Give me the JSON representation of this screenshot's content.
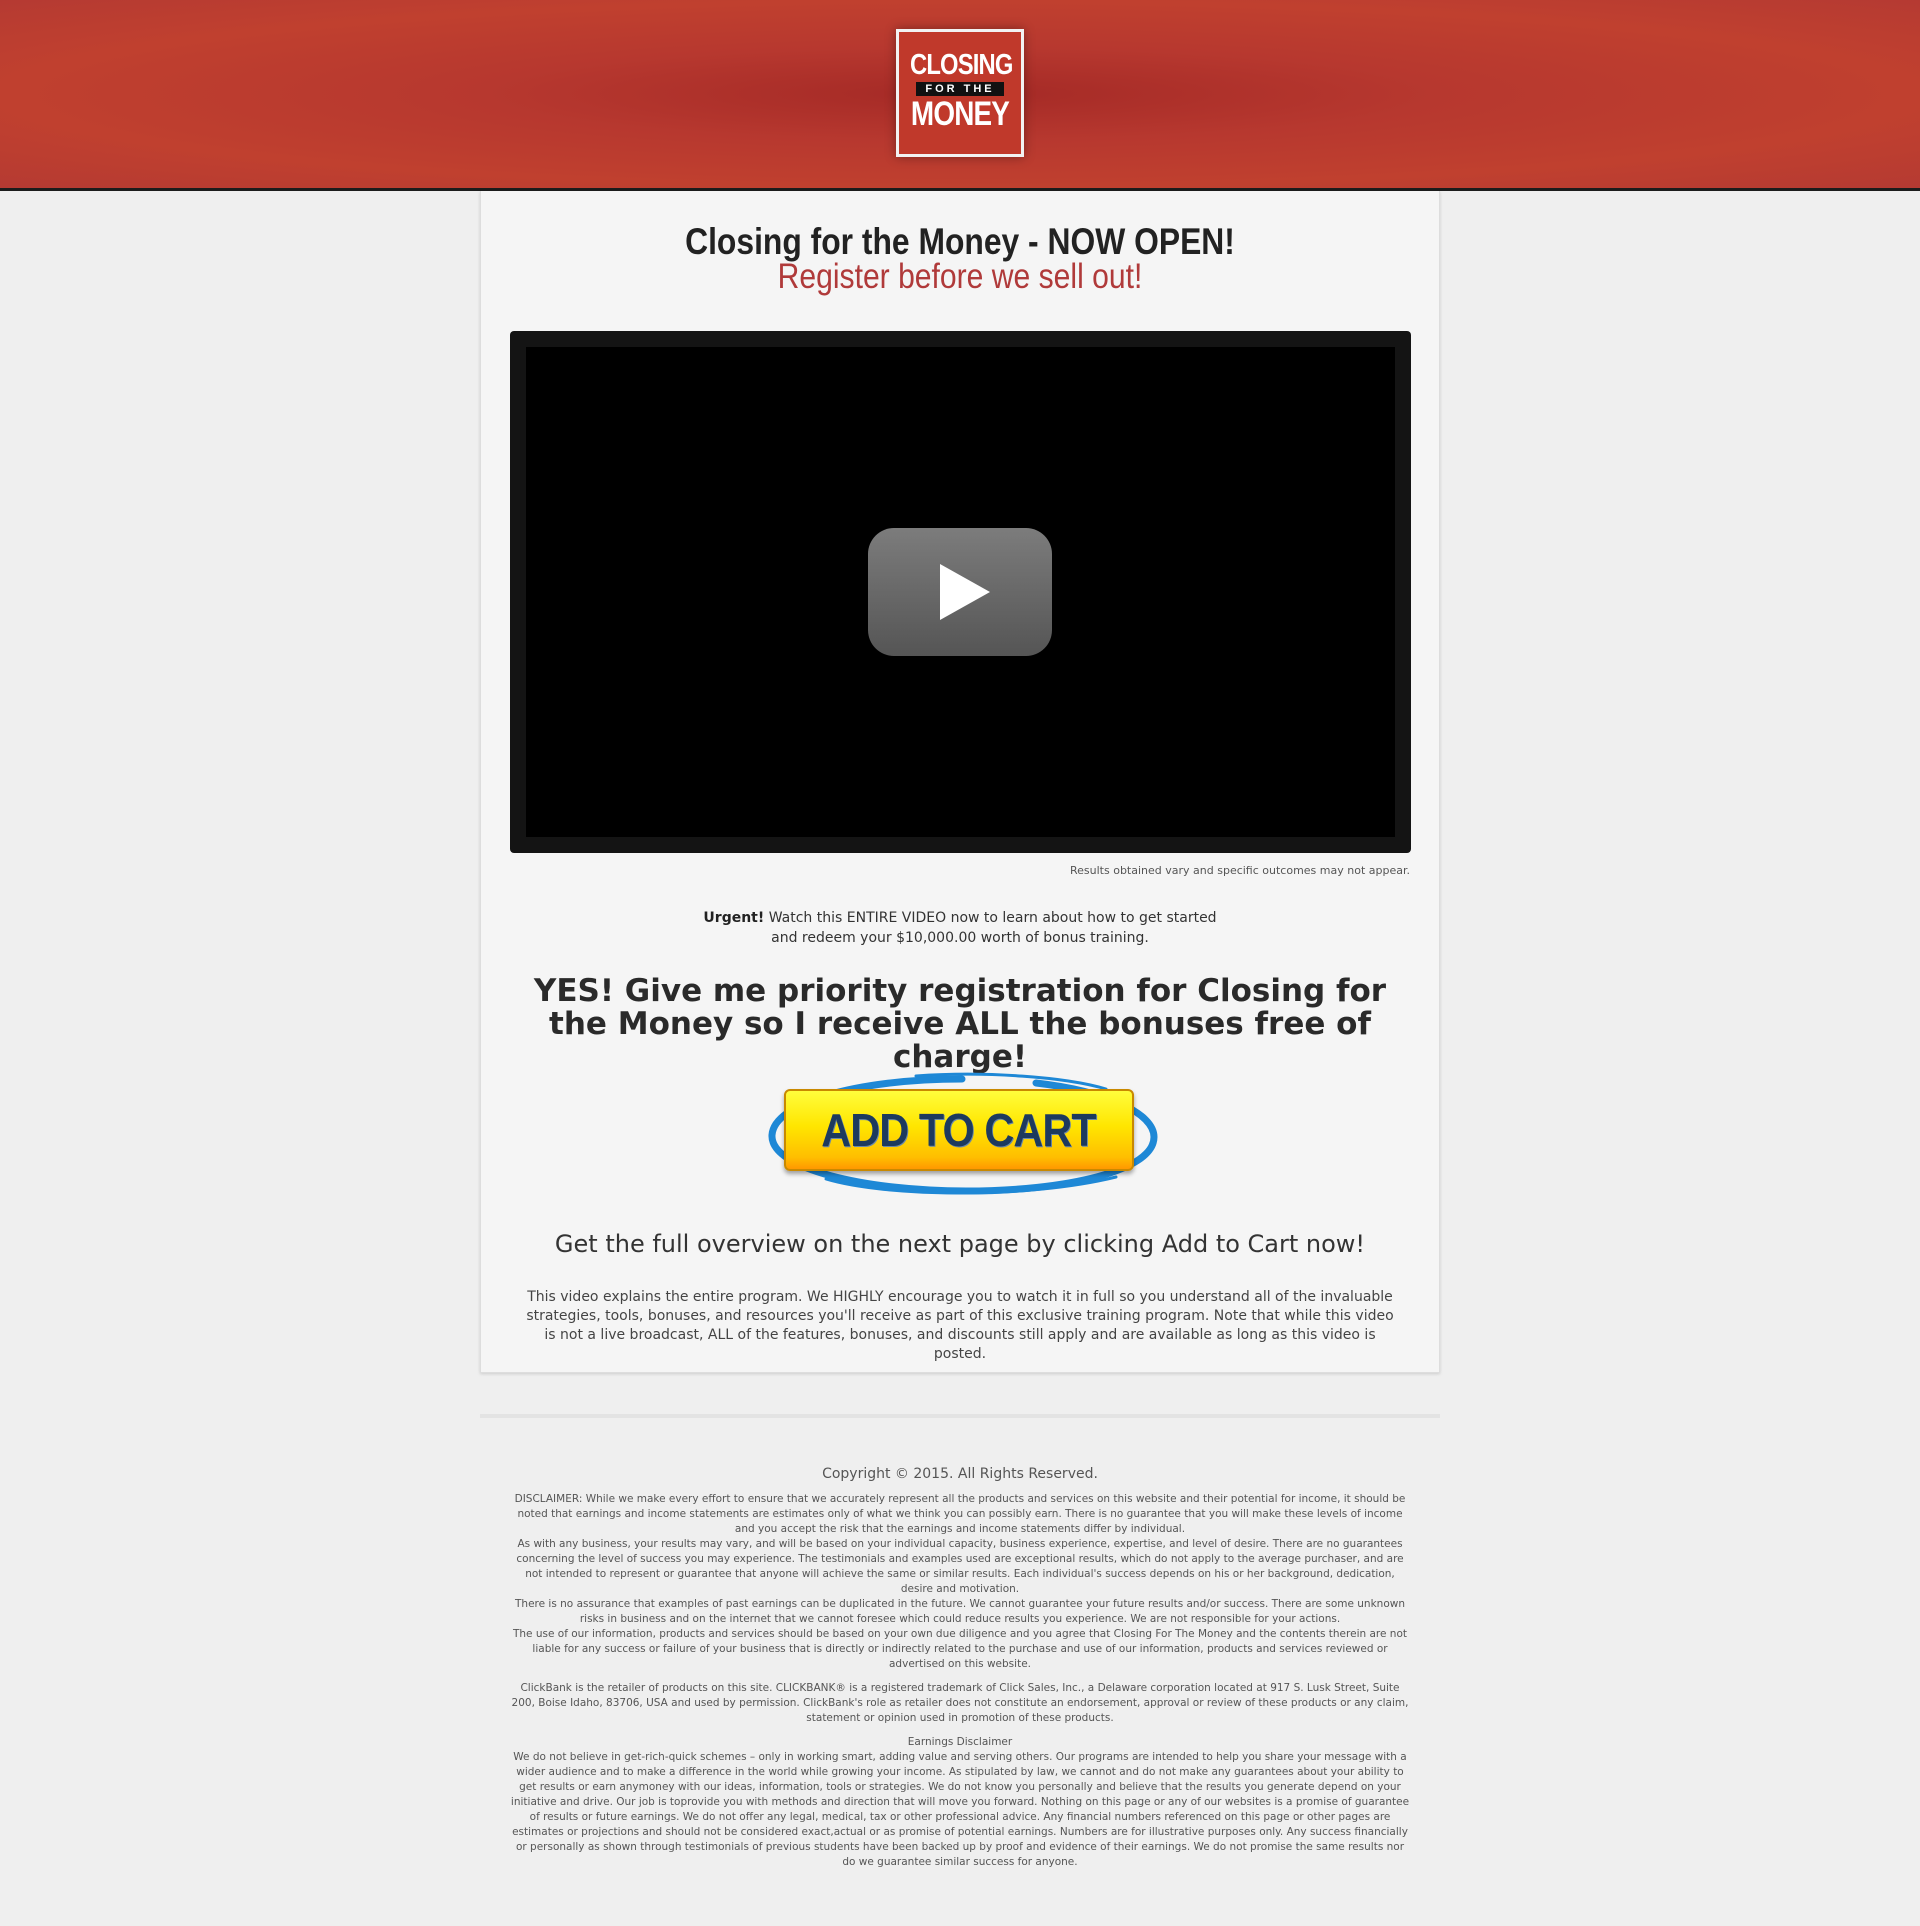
{
  "header": {
    "logo_line1": "CLOSING",
    "logo_line2": "FOR THE",
    "logo_line3": "MONEY"
  },
  "main": {
    "title": "Closing for the Money - NOW OPEN!",
    "subtitle": "Register before we sell out!",
    "video": {
      "play_icon": "play-icon"
    },
    "results_note": "Results obtained vary and specific outcomes may not appear.",
    "urgent_bold": "Urgent!",
    "urgent_line1": " Watch this ENTIRE VIDEO now to learn about how to get started",
    "urgent_line2": "and redeem your $10,000.00 worth of bonus training.",
    "yes_headline": "YES! Give me priority registration for Closing for the Money so I receive ALL  the bonuses free of charge!",
    "add_to_cart_label": "ADD TO CART",
    "overview": "Get the full overview on the next page by clicking Add to Cart now!",
    "explain": "This video explains the entire program. We HIGHLY encourage you to watch it in full so you understand all of the invaluable strategies, tools, bonuses, and resources you'll receive as part of this exclusive training program. Note that while this video is not a live broadcast, ALL of the features, bonuses, and discounts still apply and are available as long as this video is posted."
  },
  "footer": {
    "copyright": "Copyright © 2015. All Rights Reserved.",
    "disclaimer_1": "DISCLAIMER: While we make every effort to ensure that we accurately represent all the products and services on this website and their potential for income, it should be noted that earnings and income statements are estimates only of what we think you can possibly earn. There is no guarantee that you will make these levels of income and you accept the risk that the earnings and income statements differ by individual.",
    "disclaimer_2": "As with any business, your results may vary, and will be based on your individual capacity, business experience, expertise, and level of desire. There are no guarantees concerning the level of success you may experience. The testimonials and examples used are exceptional results, which do not apply to the average purchaser, and are not intended to represent or guarantee that anyone will achieve the same or similar results. Each individual's success depends on his or her background, dedication, desire and motivation.",
    "disclaimer_3": "There is no assurance that examples of past earnings can be duplicated in the future. We cannot guarantee your future results and/or success. There are some unknown risks in business and on the internet that we cannot foresee which could reduce results you experience. We are not responsible for your actions.",
    "disclaimer_4": "The use of our information, products and services should be based on your own due diligence and you agree that Closing For The Money and the contents therein are not liable for any success or failure of your business that is directly or indirectly related to the purchase and use of our information, products and services reviewed or advertised on this website.",
    "clickbank": "ClickBank is the retailer of products on this site. CLICKBANK® is a registered trademark of Click Sales, Inc., a Delaware corporation located at 917 S. Lusk Street, Suite 200, Boise Idaho, 83706, USA and used by permission. ClickBank's role as retailer does not constitute an endorsement, approval or review of these products or any claim, statement or opinion used in promotion of these products.",
    "earnings_title": "Earnings Disclaimer",
    "earnings_text": "We do not believe in get-rich-quick schemes – only in working smart, adding value and serving others. Our programs are intended to help you share your message with a wider audience and to make a difference in the world while growing your income. As stipulated by law, we cannot and do not make any guarantees about your ability to get results or earn anymoney with our ideas, information, tools or strategies. We do not know you personally and believe that the results you generate depend on your initiative and drive. Our job is toprovide you with methods and direction that will move you forward. Nothing on this page or any of our websites is a promise of guarantee of results or future earnings. We do not offer any legal, medical, tax or other professional advice. Any financial numbers referenced on this page or other pages are estimates or projections and should not be considered exact,actual or as promise of potential earnings. Numbers are for illustrative purposes only. Any success financially or personally as shown through testimonials of previous students have been backed up by proof and evidence of their earnings. We do not promise the same results nor do we guarantee similar success for anyone."
  }
}
